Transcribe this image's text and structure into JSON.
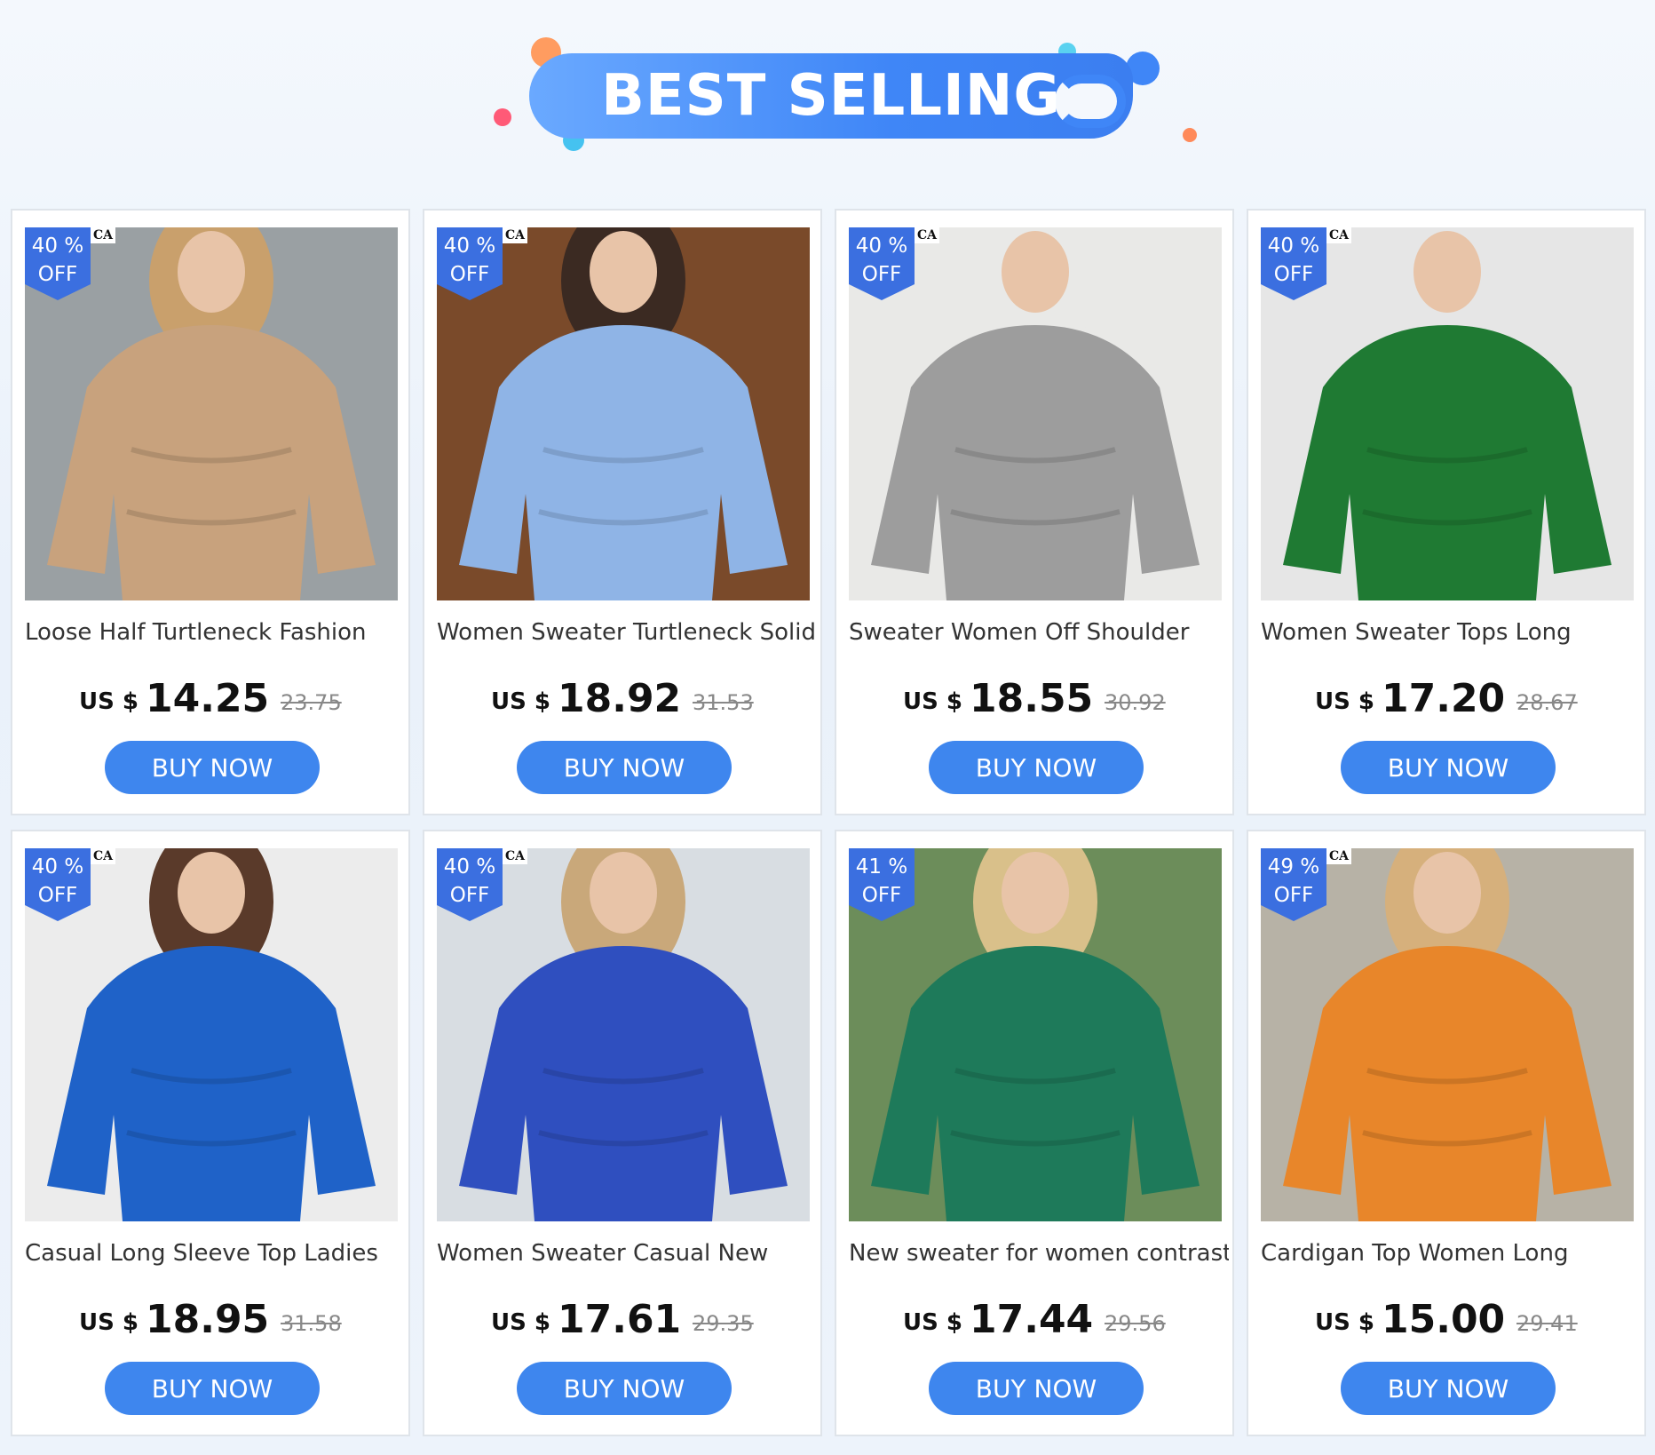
{
  "header": {
    "title": "BEST SELLING"
  },
  "colors": {
    "accent": "#3e86ee",
    "badge": "#3b6fe0",
    "banner": "#3f86f7"
  },
  "products": [
    {
      "discount_pct": "40",
      "discount_symbol": "%",
      "discount_off": "OFF",
      "title": "Loose Half Turtleneck Fashion",
      "currency": "US $",
      "price": "14.25",
      "old_price": "23.75",
      "buy_label": "BUY NOW",
      "brand_mark": "CA",
      "bg": "#9aa0a3",
      "garment": "#c8a27d",
      "hair": "#c9a06c"
    },
    {
      "discount_pct": "40",
      "discount_symbol": "%",
      "discount_off": "OFF",
      "title": "Women Sweater Turtleneck Solid",
      "currency": "US $",
      "price": "18.92",
      "old_price": "31.53",
      "buy_label": "BUY NOW",
      "brand_mark": "CA",
      "bg": "#7a4a2a",
      "garment": "#8fb4e6",
      "hair": "#3b2a22"
    },
    {
      "discount_pct": "40",
      "discount_symbol": "%",
      "discount_off": "OFF",
      "title": "Sweater Women Off Shoulder",
      "currency": "US $",
      "price": "18.55",
      "old_price": "30.92",
      "buy_label": "BUY NOW",
      "brand_mark": "CA",
      "bg": "#e9e9e7",
      "garment": "#9d9d9d",
      "hair": "#e9e9e7"
    },
    {
      "discount_pct": "40",
      "discount_symbol": "%",
      "discount_off": "OFF",
      "title": "Women Sweater Tops Long",
      "currency": "US $",
      "price": "17.20",
      "old_price": "28.67",
      "buy_label": "BUY NOW",
      "brand_mark": "CA",
      "bg": "#e6e6e6",
      "garment": "#1f7a33",
      "hair": "#e6e6e6"
    },
    {
      "discount_pct": "40",
      "discount_symbol": "%",
      "discount_off": "OFF",
      "title": "Casual Long Sleeve Top Ladies",
      "currency": "US $",
      "price": "18.95",
      "old_price": "31.58",
      "buy_label": "BUY NOW",
      "brand_mark": "CA",
      "bg": "#ececec",
      "garment": "#1f62c8",
      "hair": "#5a3a2a"
    },
    {
      "discount_pct": "40",
      "discount_symbol": "%",
      "discount_off": "OFF",
      "title": "Women Sweater Casual New",
      "currency": "US $",
      "price": "17.61",
      "old_price": "29.35",
      "buy_label": "BUY NOW",
      "brand_mark": "CA",
      "bg": "#d8dde2",
      "garment": "#2f4fbf",
      "hair": "#c9a87a"
    },
    {
      "discount_pct": "41",
      "discount_symbol": "%",
      "discount_off": "OFF",
      "title": "New sweater for women  contrast",
      "currency": "US $",
      "price": "17.44",
      "old_price": "29.56",
      "buy_label": "BUY NOW",
      "brand_mark": "",
      "bg": "#6c8d5a",
      "garment": "#1e7a5a",
      "hair": "#d9c08a"
    },
    {
      "discount_pct": "49",
      "discount_symbol": "%",
      "discount_off": "OFF",
      "title": "Cardigan Top Women Long",
      "currency": "US $",
      "price": "15.00",
      "old_price": "29.41",
      "buy_label": "BUY NOW",
      "brand_mark": "CA",
      "bg": "#b7b2a6",
      "garment": "#e8862a",
      "hair": "#d6b07c"
    }
  ]
}
